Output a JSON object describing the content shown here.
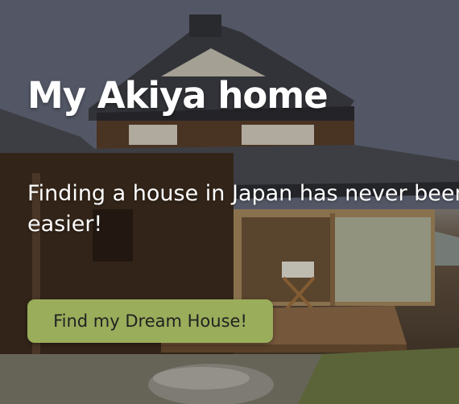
{
  "hero": {
    "title": "My Akiya home",
    "subtitle": "Finding a house in Japan has never been easier!",
    "cta_label": "Find my Dream House!",
    "background_image_icon": "japanese-house-photo-icon"
  },
  "colors": {
    "cta_background": "#9aad5b",
    "text": "#ffffff",
    "cta_text": "#222222"
  }
}
